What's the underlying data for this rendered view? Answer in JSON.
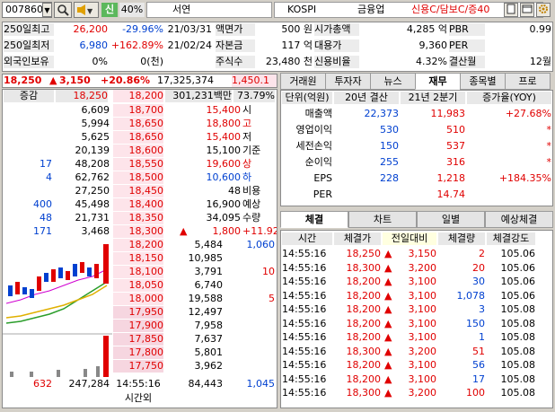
{
  "toolbar": {
    "code": "007860",
    "search_icon": "search-icon",
    "speaker_icon": "speaker-icon",
    "credit_badge": "신",
    "margin_rate": "40%",
    "stock_name": "서연",
    "market": "KOSPI",
    "sector": "금융업",
    "credit_info": "신용C/담보C/증40",
    "colors": {
      "red": "#e00000",
      "blue": "#0040d0",
      "green": "#2a9d2a"
    }
  },
  "info": {
    "rows": [
      {
        "label": "250일최고",
        "v1": "26,200",
        "v2": "-29.96%",
        "v3": "21/03/31",
        "l2": "액면가",
        "v4": "500 원",
        "l3": "시가총액",
        "v5": "4,285 억",
        "l4": "PBR",
        "v6": "0.99"
      },
      {
        "label": "250일최저",
        "v1": "6,980",
        "v2": "+162.89%",
        "v3": "21/02/24",
        "l2": "자본금",
        "v4": "117 억",
        "l3": "대용가",
        "v5": "9,360",
        "l4": "PER",
        "v6": ""
      },
      {
        "label": "외국인보유",
        "v1": "0%",
        "v2": "0(천)",
        "v3": "",
        "l2": "주식수",
        "v4": "23,480 천",
        "l3": "신용비율",
        "v5": "4.32%",
        "l4": "결산월",
        "v6": "12월"
      }
    ]
  },
  "quote": {
    "price": "18,250",
    "change": "3,150",
    "rate": "+20.86%",
    "volume": "17,325,374",
    "extra": "1,450.1"
  },
  "orderbook": {
    "header": {
      "label": "증감",
      "price": "18,250",
      "price2": "18,200",
      "amount": "301,231백만",
      "ratio": "73.79%"
    },
    "ask_rows": [
      {
        "qty": "6,609",
        "price": "18,700"
      },
      {
        "qty": "5,994",
        "price": "18,650"
      },
      {
        "qty": "5,625",
        "price": "18,650"
      },
      {
        "qty": "20,139",
        "price": "18,600"
      },
      {
        "chg": "17",
        "qty": "48,208",
        "price": "18,550"
      },
      {
        "chg": "4",
        "qty": "62,762",
        "price": "18,500"
      },
      {
        "qty": "27,250",
        "price": "18,450"
      },
      {
        "chg": "400",
        "qty": "45,498",
        "price": "18,400"
      },
      {
        "chg": "48",
        "qty": "21,731",
        "price": "18,350"
      },
      {
        "chg": "171",
        "qty": "3,468",
        "price": "18,300"
      }
    ],
    "summary": [
      {
        "v": "15,400",
        "l": "시"
      },
      {
        "v": "18,800",
        "l": "고"
      },
      {
        "v": "15,400",
        "l": "저"
      },
      {
        "v": "15,100",
        "l": "기준"
      },
      {
        "v": "19,600",
        "l": "상"
      },
      {
        "v": "10,600",
        "l": "하"
      },
      {
        "v": "48",
        "l": "비용"
      },
      {
        "v": "16,900",
        "l": "예상"
      },
      {
        "v": "34,095",
        "l": "수량"
      },
      {
        "v": "1,800",
        "l": "+11.92%"
      }
    ],
    "bid_rows": [
      {
        "price": "18,200",
        "qty": "5,484",
        "chg": "1,060"
      },
      {
        "price": "18,150",
        "qty": "10,985",
        "chg": ""
      },
      {
        "price": "18,100",
        "qty": "3,791",
        "chg": "10"
      },
      {
        "price": "18,050",
        "qty": "6,740",
        "chg": ""
      },
      {
        "price": "18,000",
        "qty": "19,588",
        "chg": "5"
      },
      {
        "price": "17,950",
        "qty": "12,497",
        "chg": ""
      },
      {
        "price": "17,900",
        "qty": "7,958",
        "chg": ""
      },
      {
        "price": "17,850",
        "qty": "7,637",
        "chg": ""
      },
      {
        "price": "17,800",
        "qty": "5,801",
        "chg": ""
      },
      {
        "price": "17,750",
        "qty": "3,962",
        "chg": ""
      }
    ],
    "footer": {
      "c1": "632",
      "c2": "247,284",
      "time": "14:55:16",
      "after": "시간외",
      "c3": "84,443",
      "c4": "1,045"
    }
  },
  "fin_tabs": [
    "거래원",
    "투자자",
    "뉴스",
    "재무",
    "종목별",
    "프로"
  ],
  "fin_active": 3,
  "financials": {
    "headers": [
      "단위(억원)",
      "20년 결산",
      "21년 2분기",
      "증가율(YOY)"
    ],
    "rows": [
      {
        "label": "매출액",
        "a": "22,373",
        "b": "11,983",
        "c": "+27.68%"
      },
      {
        "label": "영업이익",
        "a": "530",
        "b": "510",
        "c": "*"
      },
      {
        "label": "세전손익",
        "a": "150",
        "b": "537",
        "c": "*"
      },
      {
        "label": "순이익",
        "a": "255",
        "b": "316",
        "c": "*"
      },
      {
        "label": "EPS",
        "a": "228",
        "b": "1,218",
        "c": "+184.35%"
      },
      {
        "label": "PER",
        "a": "",
        "b": "14.74",
        "c": ""
      }
    ]
  },
  "trade_tabs": [
    "체결",
    "차트",
    "일별",
    "예상체결"
  ],
  "trades": {
    "headers": [
      "시간",
      "체결가",
      "전일대비",
      "체결량",
      "체결강도"
    ],
    "rows": [
      {
        "t": "14:55:16",
        "p": "18,250",
        "d": "3,150",
        "q": "2",
        "s": "105.06"
      },
      {
        "t": "14:55:16",
        "p": "18,300",
        "d": "3,200",
        "q": "20",
        "s": "105.06"
      },
      {
        "t": "14:55:16",
        "p": "18,200",
        "d": "3,100",
        "q": "30",
        "s": "105.06"
      },
      {
        "t": "14:55:16",
        "p": "18,200",
        "d": "3,100",
        "q": "1,078",
        "s": "105.06"
      },
      {
        "t": "14:55:16",
        "p": "18,200",
        "d": "3,100",
        "q": "3",
        "s": "105.08"
      },
      {
        "t": "14:55:16",
        "p": "18,200",
        "d": "3,100",
        "q": "150",
        "s": "105.08"
      },
      {
        "t": "14:55:16",
        "p": "18,200",
        "d": "3,100",
        "q": "1",
        "s": "105.08"
      },
      {
        "t": "14:55:16",
        "p": "18,300",
        "d": "3,200",
        "q": "51",
        "s": "105.08"
      },
      {
        "t": "14:55:16",
        "p": "18,200",
        "d": "3,100",
        "q": "56",
        "s": "105.08"
      },
      {
        "t": "14:55:16",
        "p": "18,200",
        "d": "3,100",
        "q": "17",
        "s": "105.08"
      },
      {
        "t": "14:55:16",
        "p": "18,300",
        "d": "3,200",
        "q": "100",
        "s": "105.08"
      }
    ]
  }
}
